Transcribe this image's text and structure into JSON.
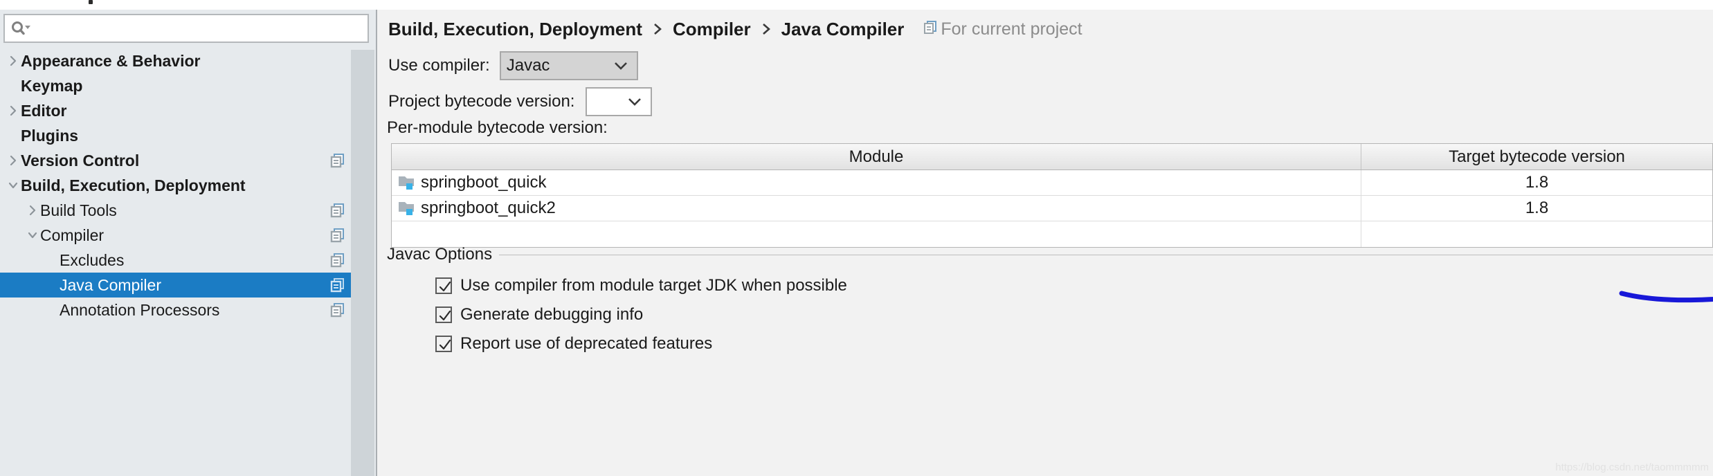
{
  "sidebar": {
    "search": {
      "value": "",
      "placeholder": "",
      "icon": "search-icon"
    },
    "items": [
      {
        "label": "Appearance & Behavior",
        "arrow": "chevron-right",
        "bold": true,
        "indent": 0,
        "copy": false,
        "selected": false
      },
      {
        "label": "Keymap",
        "arrow": "none",
        "bold": true,
        "indent": 0,
        "copy": false,
        "selected": false
      },
      {
        "label": "Editor",
        "arrow": "chevron-right",
        "bold": true,
        "indent": 0,
        "copy": false,
        "selected": false
      },
      {
        "label": "Plugins",
        "arrow": "none",
        "bold": true,
        "indent": 0,
        "copy": false,
        "selected": false
      },
      {
        "label": "Version Control",
        "arrow": "chevron-right",
        "bold": true,
        "indent": 0,
        "copy": true,
        "selected": false
      },
      {
        "label": "Build, Execution, Deployment",
        "arrow": "chevron-down",
        "bold": true,
        "indent": 0,
        "copy": false,
        "selected": false
      },
      {
        "label": "Build Tools",
        "arrow": "chevron-right",
        "bold": false,
        "indent": 1,
        "copy": true,
        "selected": false
      },
      {
        "label": "Compiler",
        "arrow": "chevron-down",
        "bold": false,
        "indent": 1,
        "copy": true,
        "selected": false
      },
      {
        "label": "Excludes",
        "arrow": "none",
        "bold": false,
        "indent": 2,
        "copy": true,
        "selected": false
      },
      {
        "label": "Java Compiler",
        "arrow": "none",
        "bold": false,
        "indent": 2,
        "copy": true,
        "selected": true
      },
      {
        "label": "Annotation Processors",
        "arrow": "none",
        "bold": false,
        "indent": 2,
        "copy": true,
        "selected": false
      }
    ],
    "selected_bg": "#1b7cc4",
    "bg": "#e6eaed"
  },
  "breadcrumb": {
    "crumbs": [
      "Build, Execution, Deployment",
      "Compiler",
      "Java Compiler"
    ],
    "separator": "chevron-right-icon",
    "note_label": "For current project",
    "note_icon": "copy-icon",
    "note_color": "#8b8b8b"
  },
  "form": {
    "use_compiler": {
      "label": "Use compiler:",
      "value": "Javac",
      "icon": "chevron-down-icon"
    },
    "project_bytecode": {
      "label": "Project bytecode version:",
      "value": "",
      "icon": "chevron-down-icon"
    },
    "per_module_label": "Per-module bytecode version:"
  },
  "table": {
    "columns": [
      "Module",
      "Target bytecode version"
    ],
    "rows": [
      {
        "module": "springboot_quick",
        "target": "1.8",
        "icon": "module-folder-icon"
      },
      {
        "module": "springboot_quick2",
        "target": "1.8",
        "icon": "module-folder-icon"
      }
    ]
  },
  "javac": {
    "title": "Javac Options",
    "options": [
      {
        "label": "Use compiler from module target JDK when possible",
        "checked": true
      },
      {
        "label": "Generate debugging info",
        "checked": true
      },
      {
        "label": "Report use of deprecated features",
        "checked": true
      }
    ]
  },
  "annotation": {
    "type": "blue-hand-drawn-underline",
    "color": "#1818d8"
  },
  "watermark": {
    "text": "https://blog.csdn.net/taommmmm"
  }
}
